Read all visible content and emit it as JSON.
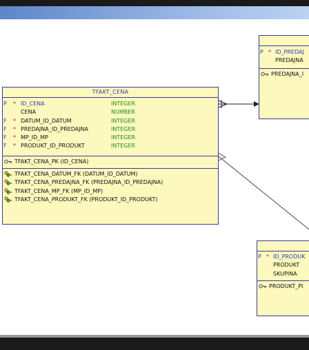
{
  "diagram": {
    "main_table": {
      "title": "TFAKT_CENA",
      "columns": [
        {
          "key": "P",
          "mandatory": "*",
          "name": "ID_CENA",
          "type": "INTEGER"
        },
        {
          "key": "",
          "mandatory": "",
          "name": "CENA",
          "type": "NUMBER"
        },
        {
          "key": "F",
          "mandatory": "*",
          "name": "DATUM_ID_DATUM",
          "type": "INTEGER"
        },
        {
          "key": "F",
          "mandatory": "*",
          "name": "PREDAJNA_ID_PREDAJNA",
          "type": "INTEGER"
        },
        {
          "key": "F",
          "mandatory": "*",
          "name": "MP_ID_MP",
          "type": "INTEGER"
        },
        {
          "key": "F",
          "mandatory": "*",
          "name": "PRODUKT_ID_PRODUKT",
          "type": "INTEGER"
        }
      ],
      "primary_key": "TFAKT_CENA_PK (ID_CENA)",
      "foreign_keys": [
        "TFAKT_CENA_DATUM_FK (DATUM_ID_DATUM)",
        "TFAKT_CENA_PREDAJNA_FK (PREDAJNA_ID_PREDAJNA)",
        "TFAKT_CENA_MP_FK (MP_ID_MP)",
        "TFAKT_CENA_PRODUKT_FK (PRODUKT_ID_PRODUKT)"
      ]
    },
    "predajna_table": {
      "columns": [
        {
          "key": "P",
          "mandatory": "*",
          "name": "ID_PREDAJ"
        },
        {
          "key": "",
          "mandatory": "",
          "name": "PREDAJNA"
        }
      ],
      "primary_key": "PREDAJNA_I"
    },
    "produkt_table": {
      "columns": [
        {
          "key": "P",
          "mandatory": "*",
          "name": "ID_PRODUK"
        },
        {
          "key": "",
          "mandatory": "",
          "name": "PRODUKT"
        },
        {
          "key": "",
          "mandatory": "",
          "name": "SKUPINA"
        }
      ],
      "primary_key": "PRODUKT_PI"
    },
    "colors": {
      "table_fill": "#fdf8bd",
      "border": "#3a3a9a",
      "pk_text": "#2b3fb0",
      "type_text": "#1f8a20",
      "mandatory_star": "#c0202a"
    }
  }
}
